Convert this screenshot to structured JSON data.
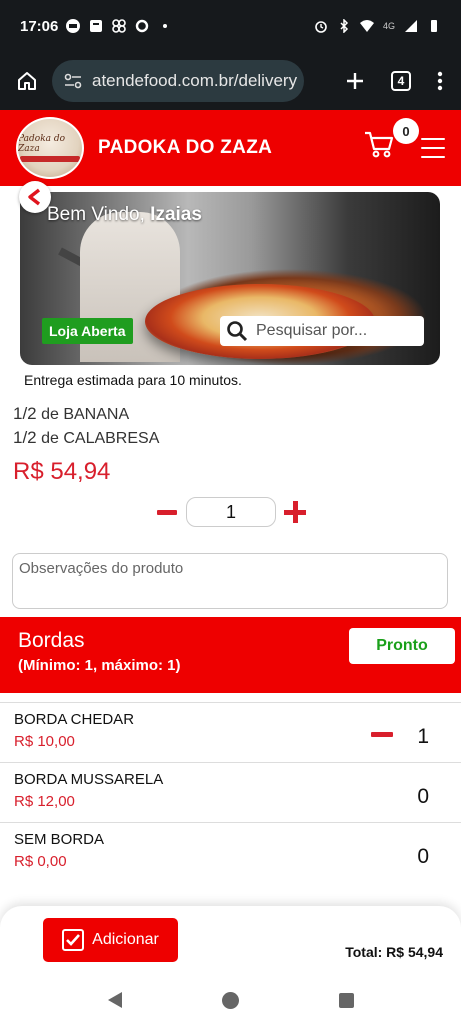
{
  "status_bar": {
    "time": "17:06",
    "network_label": "4G",
    "icons": [
      "news-icon",
      "message-icon",
      "fan-icon",
      "record-icon",
      "dot-icon",
      "alarm-icon",
      "bluetooth-icon",
      "wifi-icon",
      "signal-icon",
      "battery-icon"
    ]
  },
  "browser": {
    "url": "atendefood.com.br/delivery",
    "tab_count": "4"
  },
  "header": {
    "store_name": "PADOKA DO ZAZA",
    "logo_text": "Padoka do Zaza",
    "cart_count": "0",
    "brand_color": "#ee0000"
  },
  "banner": {
    "welcome": "Bem Vindo,",
    "user_name": "Izaias",
    "status_badge": "Loja Aberta",
    "search_placeholder": "Pesquisar por...",
    "delivery_estimate": "Entrega estimada para 10 minutos."
  },
  "product": {
    "half1_frac": "1/2",
    "half1_text": "de BANANA",
    "half2_frac": "1/2",
    "half2_text": "de CALABRESA",
    "price": "R$ 54,94",
    "quantity": "1",
    "notes_placeholder": "Observações do produto"
  },
  "section": {
    "title": "Bordas",
    "subtitle": "(Mínimo: 1, máximo: 1)",
    "ready_label": "Pronto",
    "options": [
      {
        "name": "BORDA CHEDAR",
        "price": "R$ 10,00",
        "qty": "1"
      },
      {
        "name": "BORDA MUSSARELA",
        "price": "R$ 12,00",
        "qty": "0"
      },
      {
        "name": "SEM BORDA",
        "price": "R$ 0,00",
        "qty": "0"
      }
    ]
  },
  "footer": {
    "add_label": "Adicionar",
    "total": "Total: R$ 54,94"
  }
}
